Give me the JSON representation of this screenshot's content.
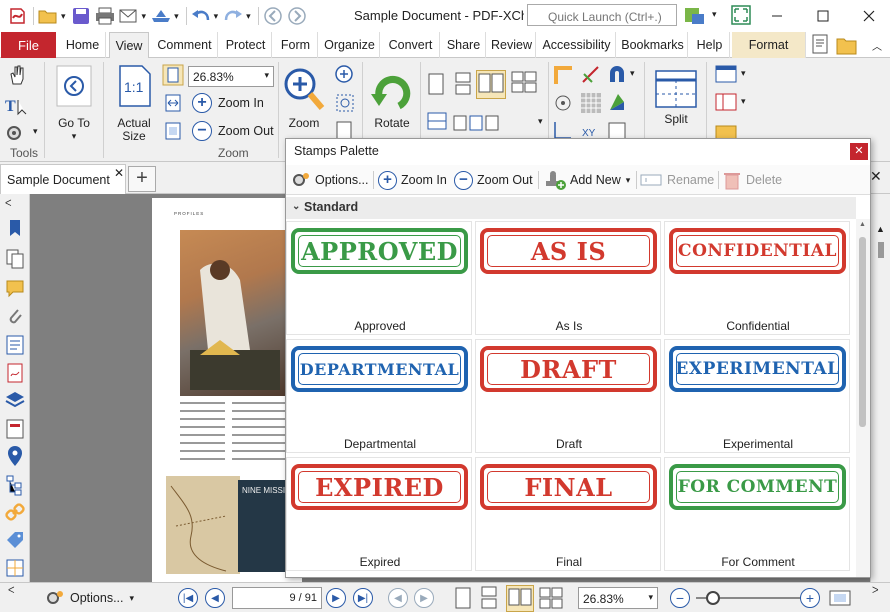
{
  "window": {
    "title": "Sample Document - PDF-XCha...",
    "quick_launch_placeholder": "Quick Launch (Ctrl+.)"
  },
  "ribbon_tabs": [
    {
      "label": "File"
    },
    {
      "label": "Home"
    },
    {
      "label": "View"
    },
    {
      "label": "Comment"
    },
    {
      "label": "Protect"
    },
    {
      "label": "Form"
    },
    {
      "label": "Organize"
    },
    {
      "label": "Convert"
    },
    {
      "label": "Share"
    },
    {
      "label": "Review"
    },
    {
      "label": "Accessibility"
    },
    {
      "label": "Bookmarks"
    },
    {
      "label": "Help"
    },
    {
      "label": "Format"
    }
  ],
  "ribbon": {
    "tools_label": "Tools",
    "goto_label": "Go To",
    "actual_size_label": "Actual Size",
    "zoom_value": "26.83%",
    "zoom_in_label": "Zoom In",
    "zoom_out_label": "Zoom Out",
    "zoom_group_label": "Zoom",
    "zoom_tool_label": "Zoom",
    "rotate_label": "Rotate",
    "split_label": "Split"
  },
  "document_tab": {
    "label": "Sample Document"
  },
  "page_content": {
    "profiles": "PROFILES",
    "nine_miss": "NINE MISSI"
  },
  "palette": {
    "title": "Stamps Palette",
    "toolbar": {
      "options": "Options...",
      "zoom_in": "Zoom In",
      "zoom_out": "Zoom Out",
      "add_new": "Add New",
      "rename": "Rename",
      "delete": "Delete"
    },
    "category": "Standard",
    "stamps": [
      {
        "text": "APPROVED",
        "name": "Approved",
        "color": "#3a9a47"
      },
      {
        "text": "AS IS",
        "name": "As Is",
        "color": "#d2392e"
      },
      {
        "text": "CONFIDENTIAL",
        "name": "Confidential",
        "color": "#d2392e"
      },
      {
        "text": "DEPARTMENTAL",
        "name": "Departmental",
        "color": "#1f63b0"
      },
      {
        "text": "DRAFT",
        "name": "Draft",
        "color": "#d2392e"
      },
      {
        "text": "EXPERIMENTAL",
        "name": "Experimental",
        "color": "#1f63b0"
      },
      {
        "text": "EXPIRED",
        "name": "Expired",
        "color": "#d2392e"
      },
      {
        "text": "FINAL",
        "name": "Final",
        "color": "#d2392e"
      },
      {
        "text": "FOR COMMENT",
        "name": "For Comment",
        "color": "#3a9a47"
      }
    ]
  },
  "statusbar": {
    "options": "Options...",
    "page_current": "9",
    "page_total": "91",
    "zoom_value": "26.83%"
  },
  "colors": {
    "accent_red": "#c4262e",
    "nav_blue": "#2a5aa8"
  }
}
